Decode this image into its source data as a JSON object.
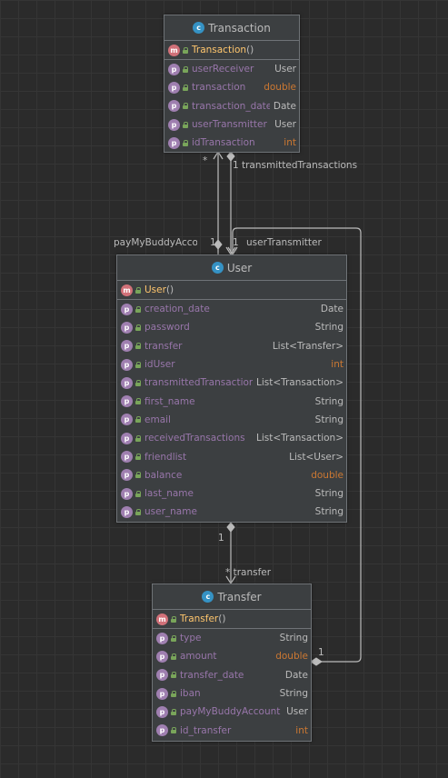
{
  "classes": {
    "transaction": {
      "name": "Transaction",
      "constructor": "Transaction",
      "fields": [
        {
          "name": "userReceiver",
          "type": "User",
          "prim": false
        },
        {
          "name": "transaction",
          "type": "double",
          "prim": true
        },
        {
          "name": "transaction_date",
          "type": "Date",
          "prim": false
        },
        {
          "name": "userTransmitter",
          "type": "User",
          "prim": false
        },
        {
          "name": "idTransaction",
          "type": "int",
          "prim": true
        }
      ]
    },
    "user": {
      "name": "User",
      "constructor": "User",
      "fields": [
        {
          "name": "creation_date",
          "type": "Date",
          "prim": false
        },
        {
          "name": "password",
          "type": "String",
          "prim": false
        },
        {
          "name": "transfer",
          "type": "List<Transfer>",
          "prim": false
        },
        {
          "name": "idUser",
          "type": "int",
          "prim": true
        },
        {
          "name": "transmittedTransactions",
          "type": "List<Transaction>",
          "prim": false
        },
        {
          "name": "first_name",
          "type": "String",
          "prim": false
        },
        {
          "name": "email",
          "type": "String",
          "prim": false
        },
        {
          "name": "receivedTransactions",
          "type": "List<Transaction>",
          "prim": false
        },
        {
          "name": "friendlist",
          "type": "List<User>",
          "prim": false
        },
        {
          "name": "balance",
          "type": "double",
          "prim": true
        },
        {
          "name": "last_name",
          "type": "String",
          "prim": false
        },
        {
          "name": "user_name",
          "type": "String",
          "prim": false
        }
      ]
    },
    "transfer": {
      "name": "Transfer",
      "constructor": "Transfer",
      "fields": [
        {
          "name": "type",
          "type": "String",
          "prim": false
        },
        {
          "name": "amount",
          "type": "double",
          "prim": true
        },
        {
          "name": "transfer_date",
          "type": "Date",
          "prim": false
        },
        {
          "name": "iban",
          "type": "String",
          "prim": false
        },
        {
          "name": "payMyBuddyAccount",
          "type": "User",
          "prim": false
        },
        {
          "name": "id_transfer",
          "type": "int",
          "prim": true
        }
      ]
    }
  },
  "labels": {
    "tx_star": "*",
    "tx_one": "1",
    "transmitted": "transmittedTransactions",
    "paymybuddy": "payMyBuddyAccount",
    "user_one_left": "1",
    "user_one_right": "1",
    "user_transmitter": "userTransmitter",
    "user_one_bottom": "1",
    "transfer_star": "* transfer",
    "transfer_one": "1"
  },
  "icons": {
    "class": "c",
    "method": "m",
    "property": "p"
  },
  "colors": {
    "background": "#2b2b2b",
    "field_name": "#9876aa",
    "primitive_type": "#cc7832",
    "constructor": "#ffc66d",
    "class_badge": "#3592c4",
    "method_badge": "#d17179",
    "property_badge": "#9f7fb0"
  }
}
